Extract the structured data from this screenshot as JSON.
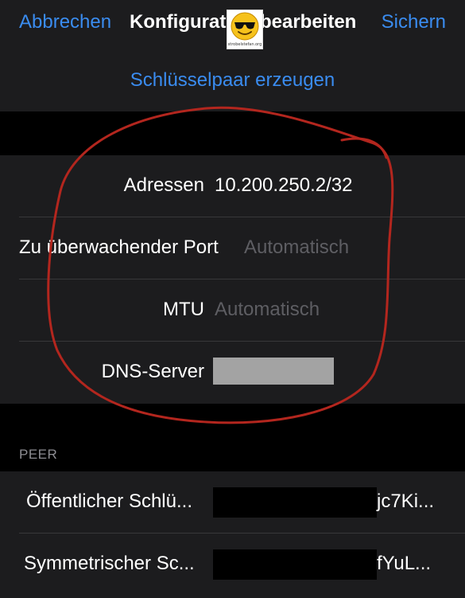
{
  "nav": {
    "cancel_label": "Abbrechen",
    "title": "Konfiguration bearbeiten",
    "save_label": "Sichern"
  },
  "logo": {
    "text": "strobelstefan.org"
  },
  "interface": {
    "generate_keypair_label": "Schlüsselpaar erzeugen",
    "fields": [
      {
        "label": "Adressen",
        "value": "10.200.250.2/32"
      },
      {
        "label": "Zu überwachender Port",
        "placeholder": "Automatisch"
      },
      {
        "label": "MTU",
        "placeholder": "Automatisch"
      },
      {
        "label": "DNS-Server",
        "value": ""
      }
    ]
  },
  "peer": {
    "section_header": "PEER",
    "fields": [
      {
        "label": "Öffentlicher Schlü...",
        "value_tail": "jc7Ki..."
      },
      {
        "label": "Symmetrischer Sc...",
        "value_tail": "fYuL..."
      }
    ]
  },
  "colors": {
    "accent": "#3a8cf0",
    "annotation": "#b3261e",
    "background": "#000000",
    "cell": "#1c1c1e"
  }
}
